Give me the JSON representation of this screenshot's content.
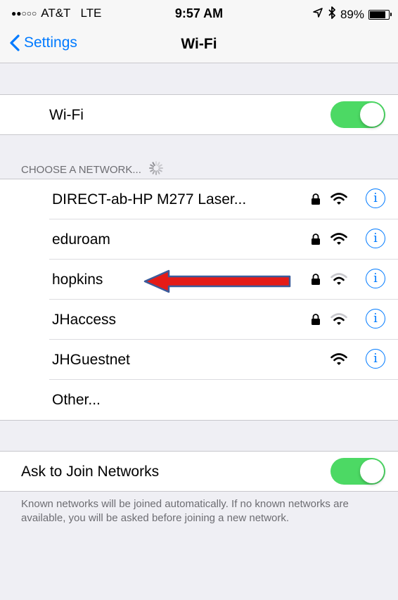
{
  "status_bar": {
    "signal_dots": "●●○○○",
    "carrier": "AT&T",
    "network_type": "LTE",
    "time": "9:57 AM",
    "location_icon": "location-arrow-icon",
    "bluetooth_icon": "bluetooth-icon",
    "battery_percent": "89%",
    "battery_level": 0.89
  },
  "nav": {
    "back_label": "Settings",
    "title": "Wi-Fi"
  },
  "wifi_toggle": {
    "label": "Wi-Fi",
    "on": true
  },
  "network_section": {
    "header": "CHOOSE A NETWORK...",
    "networks": [
      {
        "name": "DIRECT-ab-HP M277 Laser...",
        "locked": true,
        "signal": "full"
      },
      {
        "name": "eduroam",
        "locked": true,
        "signal": "full"
      },
      {
        "name": "hopkins",
        "locked": true,
        "signal": "weak"
      },
      {
        "name": "JHaccess",
        "locked": true,
        "signal": "weak"
      },
      {
        "name": "JHGuestnet",
        "locked": false,
        "signal": "full"
      }
    ],
    "other_label": "Other...",
    "info_glyph": "i"
  },
  "ask_to_join": {
    "label": "Ask to Join Networks",
    "on": true
  },
  "footer_note": "Known networks will be joined automatically. If no known networks are available, you will be asked before joining a new network.",
  "colors": {
    "accent": "#007aff",
    "toggle_on": "#4cd964",
    "arrow_fill": "#e41b17",
    "arrow_outline": "#3b5b9a",
    "background": "#efeff4"
  }
}
